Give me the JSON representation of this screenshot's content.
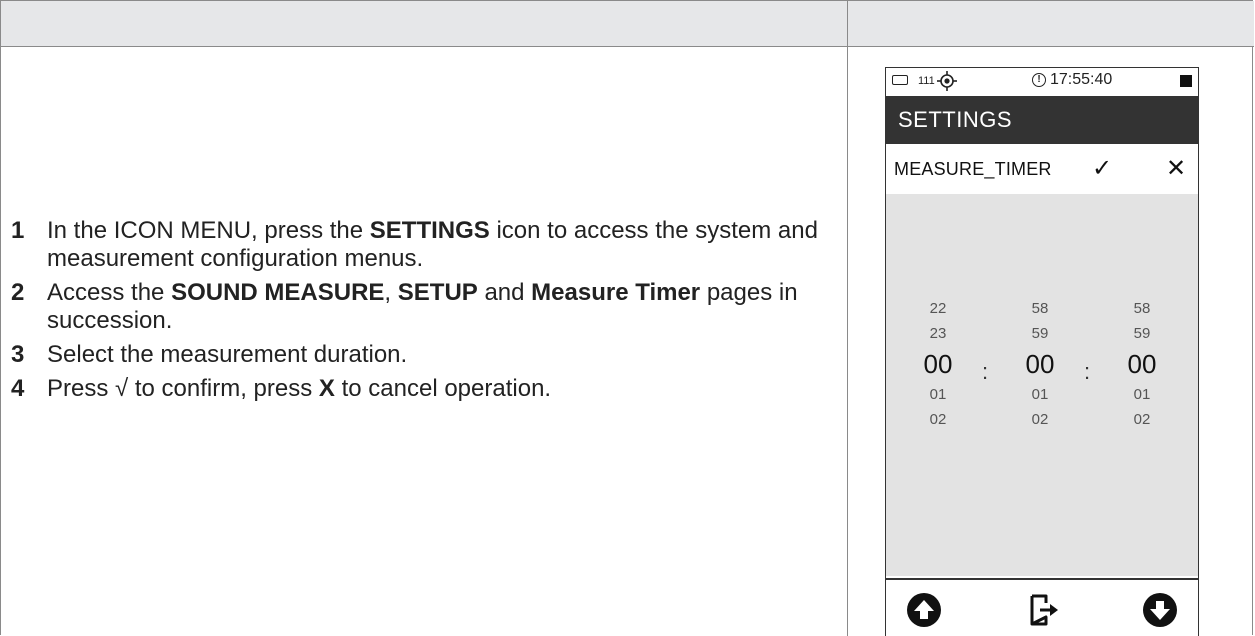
{
  "steps": [
    {
      "num": "1",
      "parts": [
        "In the ICON MENU, press the ",
        "SETTINGS",
        " icon to access the system and measurement configuration menus."
      ]
    },
    {
      "num": "2",
      "parts": [
        "Access the ",
        "SOUND MEASURE",
        ", ",
        "SETUP",
        " and ",
        "Measure Timer",
        " pages in succession."
      ]
    },
    {
      "num": "3",
      "parts": [
        "Select the measurement duration."
      ]
    },
    {
      "num": "4",
      "parts": [
        "Press  √  to confirm, press ",
        "X",
        " to cancel operation."
      ]
    }
  ],
  "device": {
    "status": {
      "signal": "111",
      "time": "17:55:40"
    },
    "title": "SETTINGS",
    "option": {
      "label": "MEASURE_TIMER",
      "confirm": "✓",
      "cancel": "✕"
    },
    "picker": {
      "hours": [
        "22",
        "23",
        "00",
        "01",
        "02"
      ],
      "minutes": [
        "58",
        "59",
        "00",
        "01",
        "02"
      ],
      "seconds": [
        "58",
        "59",
        "00",
        "01",
        "02"
      ],
      "separator": ":"
    },
    "nav": {
      "up": "up-arrow-icon",
      "exit": "exit-icon",
      "down": "down-arrow-icon"
    }
  }
}
